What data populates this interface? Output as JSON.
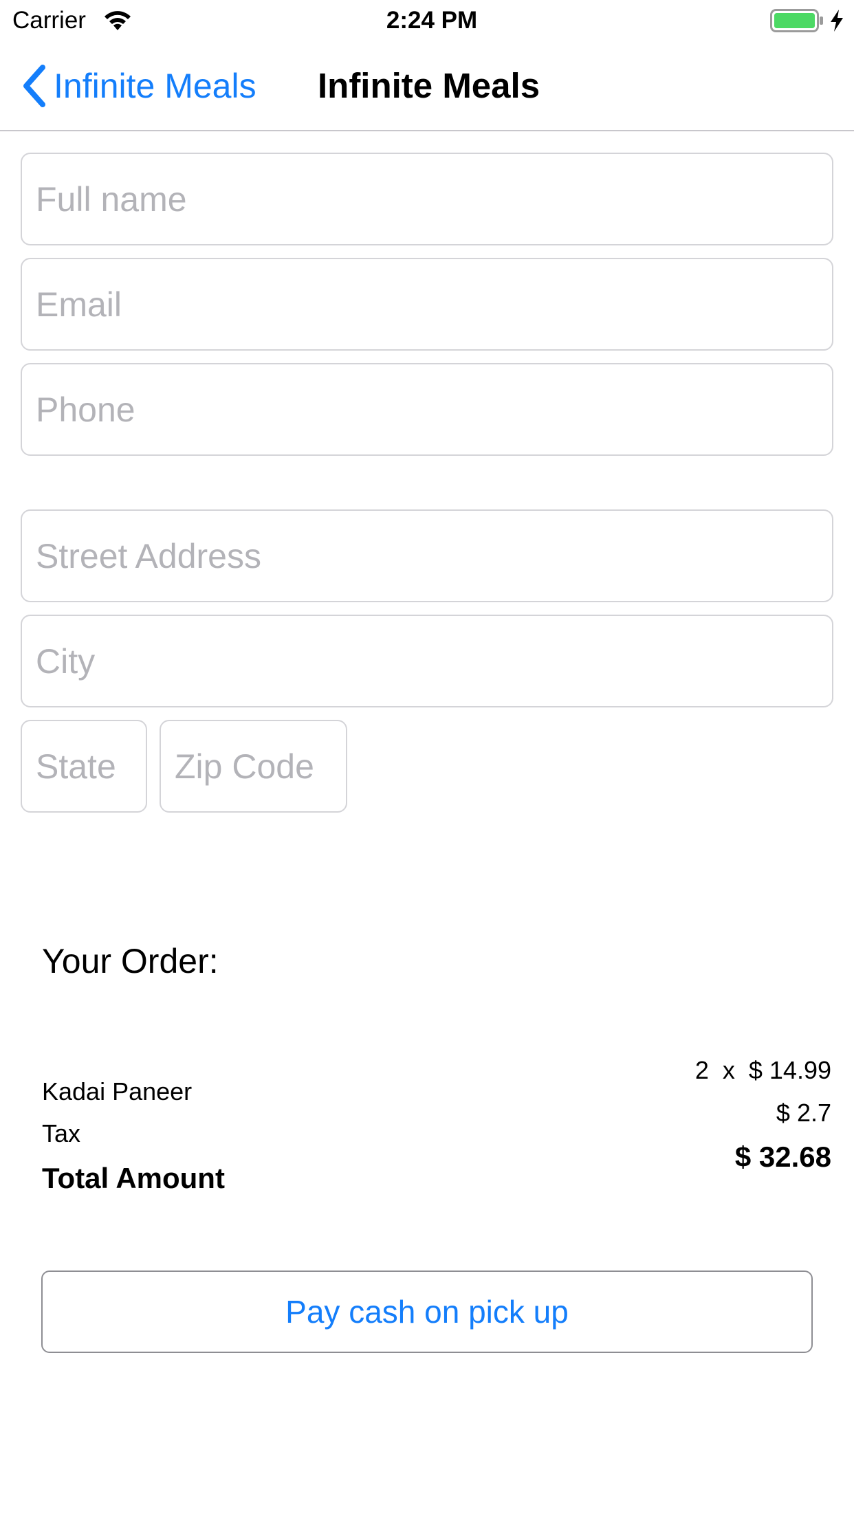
{
  "status_bar": {
    "carrier": "Carrier",
    "time": "2:24 PM",
    "battery_color": "#4cd964",
    "icons": [
      "wifi-icon",
      "battery-icon",
      "charging-bolt-icon"
    ]
  },
  "nav_bar": {
    "back_label": "Infinite Meals",
    "title": "Infinite Meals",
    "accent_color": "#147efb",
    "back_icon": "chevron-left-icon"
  },
  "form": {
    "full_name": {
      "value": "",
      "placeholder": "Full name"
    },
    "email": {
      "value": "",
      "placeholder": "Email"
    },
    "phone": {
      "value": "",
      "placeholder": "Phone"
    },
    "street_address": {
      "value": "",
      "placeholder": "Street Address"
    },
    "city": {
      "value": "",
      "placeholder": "City"
    },
    "state": {
      "value": "",
      "placeholder": "State"
    },
    "zip_code": {
      "value": "",
      "placeholder": "Zip Code"
    }
  },
  "order": {
    "heading": "Your Order:",
    "item": {
      "name": "Kadai Paneer",
      "quantity_price": "2  x  $ 14.99"
    },
    "tax": {
      "label": "Tax",
      "value": "$ 2.7"
    },
    "total": {
      "label": "Total Amount",
      "value": "$ 32.68"
    }
  },
  "actions": {
    "pay_label": "Pay cash on pick up"
  }
}
